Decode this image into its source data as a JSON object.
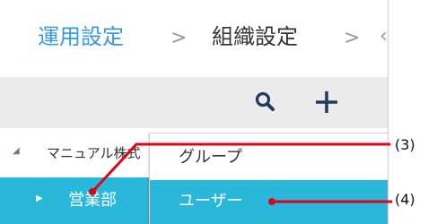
{
  "breadcrumb": {
    "items": [
      "運用設定",
      "組織設定"
    ],
    "separator": ">",
    "truncated": "‹"
  },
  "toolbar": {
    "search_icon": "search-icon",
    "add_icon": "plus-icon"
  },
  "tree": {
    "company_label": "マニュアル株式",
    "department_label": "営業部",
    "expanded_glyph": "◢",
    "collapsed_glyph": "▶"
  },
  "context_menu": {
    "items": [
      "グループ",
      "ユーザー"
    ],
    "selected_index": 1
  },
  "callouts": {
    "label_3": "(3)",
    "label_4": "(4)"
  },
  "colors": {
    "breadcrumb_link": "#3a9ad9",
    "selection": "#29b8d9",
    "toolbar_bg": "#ebebeb",
    "callout_line": "#e0001a",
    "icon": "#1f3a5a"
  }
}
